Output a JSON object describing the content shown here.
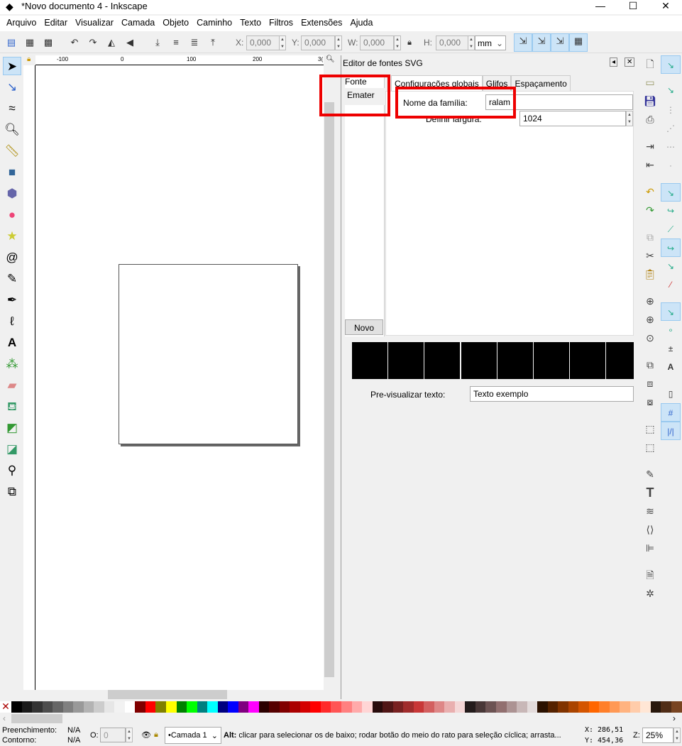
{
  "window": {
    "title": "*Novo documento 4 - Inkscape",
    "minimize": "—",
    "maximize": "☐",
    "close": "✕"
  },
  "menu": [
    "Arquivo",
    "Editar",
    "Visualizar",
    "Camada",
    "Objeto",
    "Caminho",
    "Texto",
    "Filtros",
    "Extensões",
    "Ajuda"
  ],
  "toolbar": {
    "x_label": "X:",
    "x": "0,000",
    "y_label": "Y:",
    "y": "0,000",
    "w_label": "W:",
    "w": "0,000",
    "h_label": "H:",
    "h": "0,000",
    "unit": "mm"
  },
  "ruler": {
    "ticks": [
      "-100",
      "0",
      "100",
      "200",
      "3("
    ]
  },
  "dialog": {
    "title": "Editor de fontes SVG",
    "font_list_header": "Fonte",
    "fonts": [
      " Emater"
    ],
    "new_button": "Novo",
    "tabs": [
      "Configurações globais",
      "Glifos",
      "Espaçamento"
    ],
    "family_label": "Nome da família:",
    "family_value": "ralam",
    "width_label": "Definir largura:",
    "width_value": "1024",
    "preview_label": "Pre-visualizar texto:",
    "preview_value": "Texto exemplo"
  },
  "palette": [
    "#000000",
    "#1a1a1a",
    "#333333",
    "#4d4d4d",
    "#666666",
    "#808080",
    "#999999",
    "#b3b3b3",
    "#cccccc",
    "#e6e6e6",
    "#f2f2f2",
    "#ffffff",
    "#800000",
    "#ff0000",
    "#808000",
    "#ffff00",
    "#008000",
    "#00ff00",
    "#008080",
    "#00ffff",
    "#000080",
    "#0000ff",
    "#800080",
    "#ff00ff",
    "#2b0000",
    "#550000",
    "#800000",
    "#aa0000",
    "#d40000",
    "#ff0000",
    "#ff2a2a",
    "#ff5555",
    "#ff8080",
    "#ffaaaa",
    "#ffd5d5",
    "#280b0b",
    "#501616",
    "#782121",
    "#a02c2c",
    "#c83737",
    "#d35f5f",
    "#de8787",
    "#e9afaf",
    "#f4d7d7",
    "#241c1c",
    "#483737",
    "#6c5353",
    "#916f6f",
    "#ac9393",
    "#c8b7b7",
    "#e3dbdb",
    "#2b1100",
    "#552200",
    "#803300",
    "#aa4400",
    "#d45500",
    "#ff6600",
    "#ff7f2a",
    "#ff9955",
    "#ffb380",
    "#ffccaa",
    "#ffe6d5",
    "#28170b",
    "#502d16",
    "#784421"
  ],
  "status": {
    "fill_label": "Preenchimento:",
    "fill": "N/A",
    "stroke_label": "Contorno:",
    "stroke": "N/A",
    "opacity_label": "O:",
    "opacity": "0",
    "layer": "•Camada 1",
    "message_bold": "Alt:",
    "message": " clicar para selecionar os de baixo; rodar botão do meio do rato para seleção cíclica; arrasta...",
    "x_label": "X:",
    "x": "286,51",
    "y_label": "Y:",
    "y": "454,36",
    "zoom_label": "Z:",
    "zoom": "25%"
  }
}
